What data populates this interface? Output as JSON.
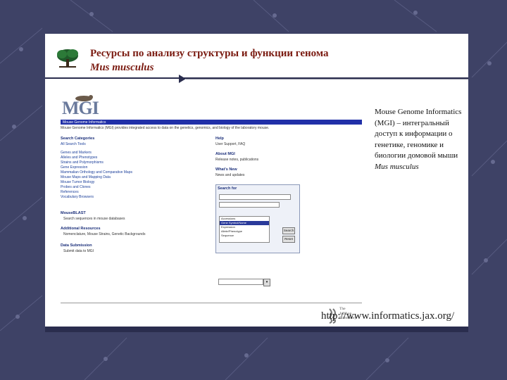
{
  "slide": {
    "title_line1": "Ресурсы по анализу структуры и функции генома",
    "title_line2": "Mus musculus",
    "description_main": "Mouse Genome Informatics (MGI) – интегральный доступ к информации о генетике, геномике и биологии домовой мыши ",
    "description_species": "Mus musculus",
    "url": "http://www.informatics.jax.org/"
  },
  "mgi": {
    "logo_text": "MGI",
    "header_bar_text": "Mouse Genome Informatics",
    "intro_text": "Mouse Genome Informatics (MGI) provides integrated access to data on the genetics, genomics, and biology of the laboratory mouse.",
    "search_categories_title": "Search Categories",
    "all_search_tools": "All Search Tools",
    "categories": [
      "Genes and Markers",
      "Alleles and Phenotypes",
      "Strains and Polymorphisms",
      "Gene Expression",
      "Mammalian Orthology and Comparative Maps",
      "Mouse Maps and Mapping Data",
      "Mouse Tumor Biology",
      "Probes and Clones",
      "References",
      "Vocabulary Browsers"
    ],
    "mouseblast_title": "MouseBLAST",
    "mouseblast_desc": "Search sequences in mouse databases",
    "additional_title": "Additional Resources",
    "additional_desc": "Nomenclature, Mouse Strains, Genetic Backgrounds",
    "submission_title": "Data Submission",
    "submission_desc": "Submit data to MGI",
    "help_title": "Help",
    "help_desc": "User Support, FAQ",
    "about_title": "About MGI",
    "about_desc": "Release notes, publications",
    "whats_new_title": "What's New",
    "whats_new_desc": "News and updates",
    "search_for_label": "Search for",
    "search_field_hint": "",
    "search_list": [
      "Accessions",
      "Gene Symbol/Name",
      "Expression",
      "Allele/Phenotype",
      "Sequence"
    ],
    "search_list_selected_index": 1,
    "search_button": "Search",
    "reset_button": "Reset",
    "dropdown_value": "",
    "dropdown_button": "▾",
    "jax_lines": [
      "The",
      "Jackson",
      "Laboratory"
    ]
  },
  "colors": {
    "background": "#3e4266",
    "title": "#7a1a10",
    "mgi_bar": "#2130a8"
  }
}
